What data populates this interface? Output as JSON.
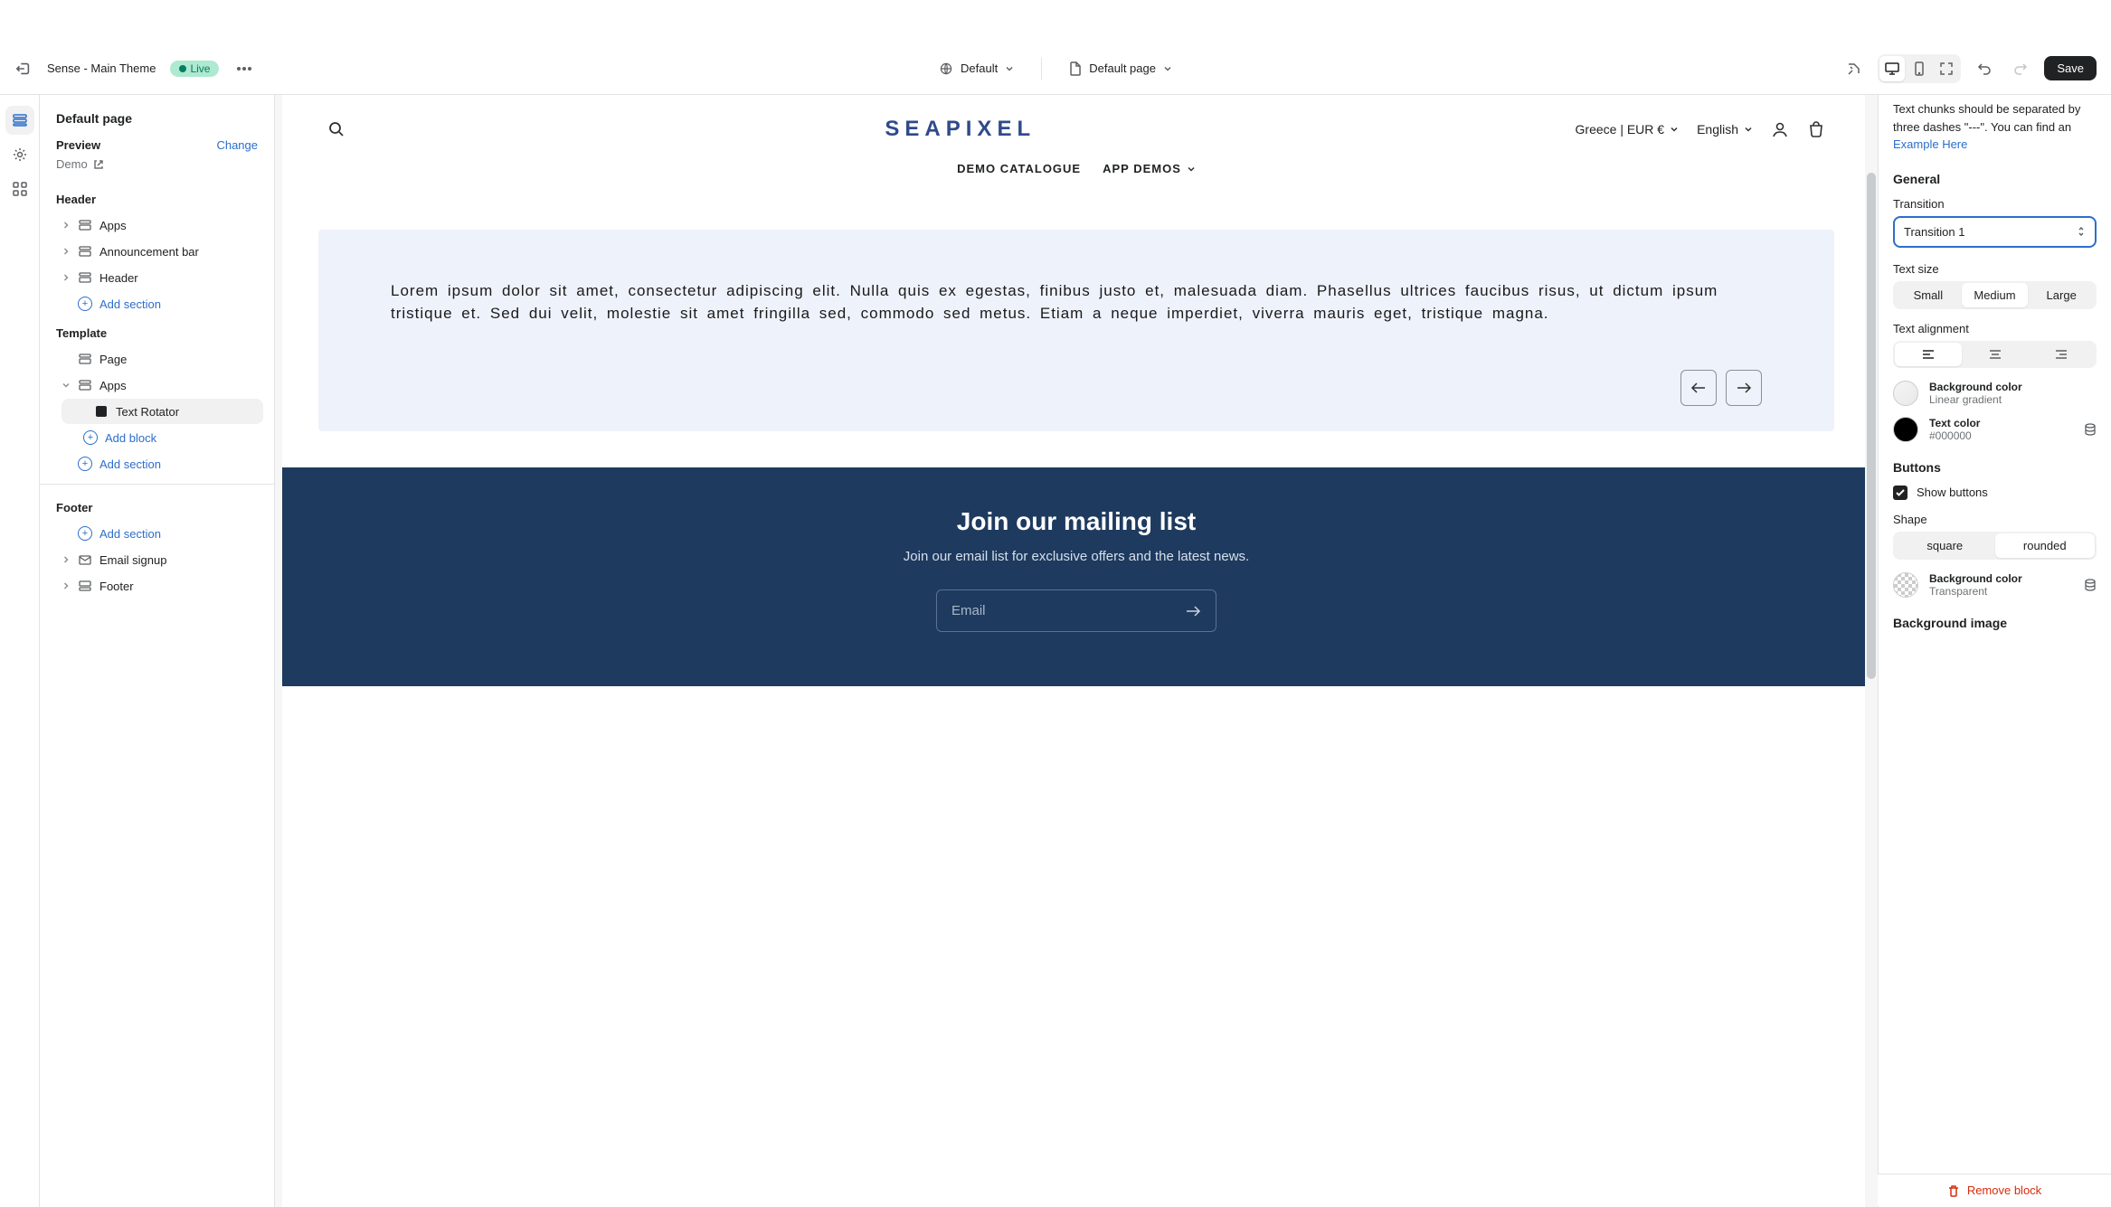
{
  "topbar": {
    "themeName": "Sense - Main Theme",
    "status": "Live",
    "localeDropdown": "Default",
    "pageDropdown": "Default page",
    "save": "Save"
  },
  "sidebar": {
    "pageTitle": "Default page",
    "previewLabel": "Preview",
    "changeLink": "Change",
    "demoLabel": "Demo",
    "addSection": "Add section",
    "addBlock": "Add block",
    "groups": {
      "header": {
        "label": "Header",
        "items": [
          "Apps",
          "Announcement bar",
          "Header"
        ]
      },
      "template": {
        "label": "Template",
        "pageItem": "Page",
        "appsItem": "Apps",
        "textRotator": "Text Rotator"
      },
      "footer": {
        "label": "Footer",
        "items": [
          "Email signup",
          "Footer"
        ]
      }
    }
  },
  "canvas": {
    "logo": "SEAPIXEL",
    "region": "Greece | EUR €",
    "language": "English",
    "nav": {
      "demoCatalogue": "DEMO CATALOGUE",
      "appDemos": "APP DEMOS"
    },
    "rotatorText": "Lorem ipsum dolor sit amet, consectetur adipiscing elit. Nulla quis ex egestas, finibus justo et, malesuada diam. Phasellus ultrices faucibus risus, ut dictum ipsum tristique et. Sed dui velit, molestie sit amet fringilla sed, commodo sed metus. Etiam a neque imperdiet, viverra mauris eget, tristique magna.",
    "mailing": {
      "heading": "Join our mailing list",
      "subtext": "Join our email list for exclusive offers and the latest news.",
      "placeholder": "Email"
    }
  },
  "inspector": {
    "hint": "Text chunks should be separated by three dashes \"---\". You can find an ",
    "hintLink": "Example Here",
    "general": {
      "heading": "General",
      "transitionLabel": "Transition",
      "transitionValue": "Transition 1",
      "textSizeLabel": "Text size",
      "sizes": [
        "Small",
        "Medium",
        "Large"
      ],
      "alignLabel": "Text alignment",
      "bgColor": {
        "label": "Background color",
        "value": "Linear gradient"
      },
      "textColor": {
        "label": "Text color",
        "value": "#000000"
      }
    },
    "buttons": {
      "heading": "Buttons",
      "showLabel": "Show buttons",
      "shapeLabel": "Shape",
      "shapes": [
        "square",
        "rounded"
      ],
      "bgColor": {
        "label": "Background color",
        "value": "Transparent"
      }
    },
    "bgImage": {
      "heading": "Background image"
    },
    "remove": "Remove block"
  }
}
